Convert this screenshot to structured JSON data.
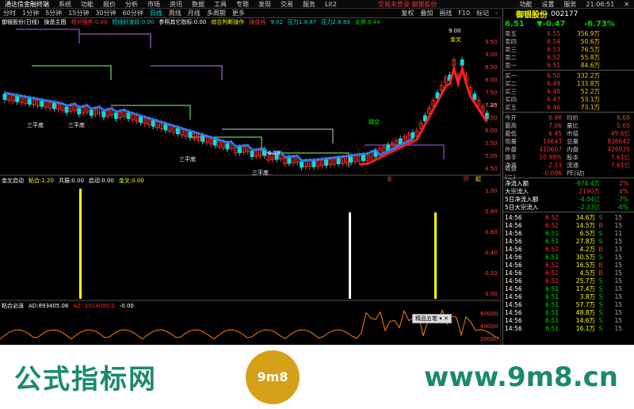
{
  "menu": [
    "通达信金融终端",
    "系统",
    "功能",
    "报价",
    "分析",
    "市场",
    "资讯",
    "数据",
    "工具",
    "专题",
    "发现",
    "交易",
    "服务",
    "Lit2"
  ],
  "title_center": "交易未登录  御银股份",
  "title_right": [
    "功能",
    "设置",
    "服务"
  ],
  "time": "21:06:51",
  "tabs": [
    "分时",
    "1分钟",
    "5分钟",
    "15分钟",
    "30分钟",
    "60分钟",
    "日线",
    "周线",
    "月线",
    "多周期",
    "更多"
  ],
  "tab_right": [
    "复权",
    "叠加",
    "画线",
    "F10",
    "标记",
    "-"
  ],
  "stock": {
    "name": "御银股份",
    "code": "002177",
    "price": "6.51",
    "change": "▼-0.47",
    "pct": "-6.73%"
  },
  "info1": {
    "prefix": "御银股份(日线)",
    "main": "操盘主图",
    "a": "相对强势:0.00",
    "b": "短线好波段:0.00",
    "c": "参照其它指标:0.00",
    "d": "综合判断操作",
    "e": "操盘线",
    "f": "9.02",
    "g": "压力1:8.87",
    "h": "压力2:8.83",
    "i": "支撑:8.44"
  },
  "info2": {
    "name": "金叉启动",
    "a": "粘合:1.20",
    "b": "共振:0.00",
    "c": "启动:0.00",
    "d": "金叉:0.00"
  },
  "info3": {
    "name": "粘合必涨",
    "a": "AD:893405.06",
    "b": "AZ:-1014000.0",
    "c": "-0.00"
  },
  "labels": {
    "p900": "9.00",
    "p725": "7.25",
    "p428": "4.28",
    "sanping1": "三平底",
    "sanping2": "三平底",
    "sanping3": "三平底",
    "sanping4": "三平底",
    "tiaozao": "跳空",
    "jinlu": "金叉",
    "chou": "测",
    "qi": "起",
    "jin": "金"
  },
  "price_axis": [
    "9.50",
    "9.00",
    "8.50",
    "8.00",
    "7.50",
    "7.00",
    "6.50",
    "6.00",
    "5.50",
    "5.00",
    "4.50"
  ],
  "ind_axis": [
    "1.00",
    "0.80",
    "0.60",
    "0.40",
    "0.20",
    "0.00"
  ],
  "vol_axis": [
    "60000",
    "40000",
    "20000"
  ],
  "sell": [
    [
      "卖五",
      "6.55",
      "356.9万"
    ],
    [
      "卖四",
      "6.54",
      "50.6万"
    ],
    [
      "卖三",
      "6.53",
      "76.5万"
    ],
    [
      "卖二",
      "6.52",
      "55.8万"
    ],
    [
      "卖一",
      "6.51",
      "84.6万"
    ]
  ],
  "buy": [
    [
      "买一",
      "6.50",
      "332.2万"
    ],
    [
      "买二",
      "6.49",
      "133.8万"
    ],
    [
      "买三",
      "6.48",
      "52.2万"
    ],
    [
      "买四",
      "6.47",
      "53.1万"
    ],
    [
      "买五",
      "6.46",
      "73.1万"
    ]
  ],
  "quote": [
    [
      "今开",
      "6.98",
      "均价",
      "6.68"
    ],
    [
      "最高",
      "7.06",
      "量比",
      "0.65"
    ],
    [
      "最低",
      "6.45",
      "市值",
      "49.6亿"
    ],
    [
      "现量",
      "14643",
      "总量",
      "836642"
    ],
    [
      "外盘",
      "410607",
      "内盘",
      "426035"
    ],
    [
      "换手",
      "10.99%",
      "股本",
      "7.61亿"
    ],
    [
      "净资",
      "2.13",
      "流通",
      "7.61亿"
    ],
    [
      "收益(二)",
      "-0.096",
      "PE(动)",
      ""
    ]
  ],
  "flow": [
    [
      "净流入额",
      "-974.4万",
      "2%"
    ],
    [
      "大宗流入",
      "2190万",
      "4%"
    ],
    [
      "5日净流入额",
      "-4.04亿",
      "-7%"
    ],
    [
      "5日大宗流入",
      "-2.33亿",
      "-6%"
    ]
  ],
  "ticks": [
    [
      "14:56",
      "6.52",
      "34.6万",
      "S",
      "15"
    ],
    [
      "14:56",
      "6.52",
      "14.5万",
      "B",
      "15"
    ],
    [
      "14:56",
      "6.51",
      "6.5万",
      "S",
      "11"
    ],
    [
      "14:56",
      "6.51",
      "27.8万",
      "S",
      "15"
    ],
    [
      "14:56",
      "6.52",
      "4.2万",
      "B",
      "13"
    ],
    [
      "14:56",
      "6.51",
      "30.5万",
      "S",
      "15"
    ],
    [
      "14:56",
      "6.52",
      "16.5万",
      "B",
      "15"
    ],
    [
      "14:56",
      "6.52",
      "4.5万",
      "B",
      "15"
    ],
    [
      "14:56",
      "6.52",
      "25.7万",
      "S",
      "15"
    ],
    [
      "14:56",
      "6.51",
      "17.4万",
      "S",
      "15"
    ],
    [
      "14:56",
      "6.51",
      "3.8万",
      "S",
      "15"
    ],
    [
      "14:56",
      "6.51",
      "57.7万",
      "S",
      "15"
    ],
    [
      "14:56",
      "6.51",
      "48.8万",
      "S",
      "15"
    ],
    [
      "14:56",
      "6.51",
      "14.6万",
      "S",
      "15"
    ],
    [
      "14:56",
      "6.51",
      "16.1万",
      "S",
      "15"
    ]
  ],
  "popup": "精品五笔",
  "banner": {
    "left": "公式指标网",
    "right": "www.9m8.cn",
    "logo": "9m8"
  }
}
